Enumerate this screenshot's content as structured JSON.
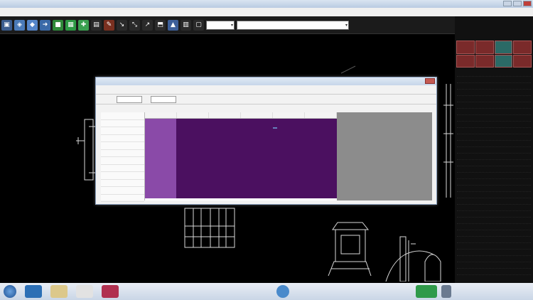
{
  "window": {
    "title": "",
    "menu": [
      "",
      "",
      "",
      "",
      "",
      "",
      "",
      "",
      "",
      "",
      "",
      "",
      ""
    ]
  },
  "toolbar": {
    "icon_names": [
      "open-icon",
      "layer-icon",
      "color-icon",
      "arrow-icon",
      "green-icon",
      "grid-icon",
      "snap-icon",
      "measure-icon",
      "edit-icon",
      "text-icon",
      "zoom-icon",
      "pan-icon",
      "window-icon",
      "print-icon",
      "view-icon",
      "settings-icon",
      "lock-icon",
      "help-icon"
    ],
    "layer_select_value": "",
    "style_select_value": ""
  },
  "right_panel": {
    "brand": "",
    "brand_sub": "",
    "items": [
      "",
      "",
      "",
      "",
      "",
      "",
      "",
      "",
      "",
      "",
      "",
      "",
      "",
      "",
      "",
      "",
      "",
      "",
      "",
      "",
      "",
      "",
      "",
      "",
      "",
      "",
      "",
      "",
      "",
      "",
      "",
      ""
    ]
  },
  "dialog": {
    "title": "",
    "menu": [
      "",
      "",
      "",
      "",
      "",
      "",
      "",
      "",
      "",
      "",
      "",
      "",
      "",
      ""
    ],
    "tools": [
      "",
      "",
      "",
      "",
      "",
      ""
    ],
    "columns": [
      "",
      "",
      "",
      "",
      "",
      ""
    ],
    "rows": [
      "",
      "",
      "",
      "",
      "",
      "",
      "",
      "",
      "",
      "",
      "",
      ""
    ],
    "cells": [
      [
        "",
        "",
        "",
        "",
        ""
      ],
      [
        "",
        "",
        "",
        "",
        ""
      ],
      [
        "",
        "",
        "",
        "",
        ""
      ],
      [
        "",
        "",
        "",
        "",
        ""
      ],
      [
        "",
        "",
        "",
        "",
        ""
      ],
      [
        "",
        "",
        "",
        "",
        ""
      ],
      [
        "",
        "",
        "",
        "",
        ""
      ],
      [
        "",
        "",
        "",
        "",
        ""
      ],
      [
        "",
        "",
        "",
        "",
        ""
      ],
      [
        "",
        "",
        "",
        "",
        ""
      ]
    ],
    "edit_cell_value": ""
  },
  "taskbar": {
    "clock": ""
  },
  "colors": {
    "cell_bg": "#4b1060",
    "cell_first_col": "#8a4aa8",
    "panel_red": "#7a2a2a",
    "panel_teal": "#2b6a66"
  }
}
